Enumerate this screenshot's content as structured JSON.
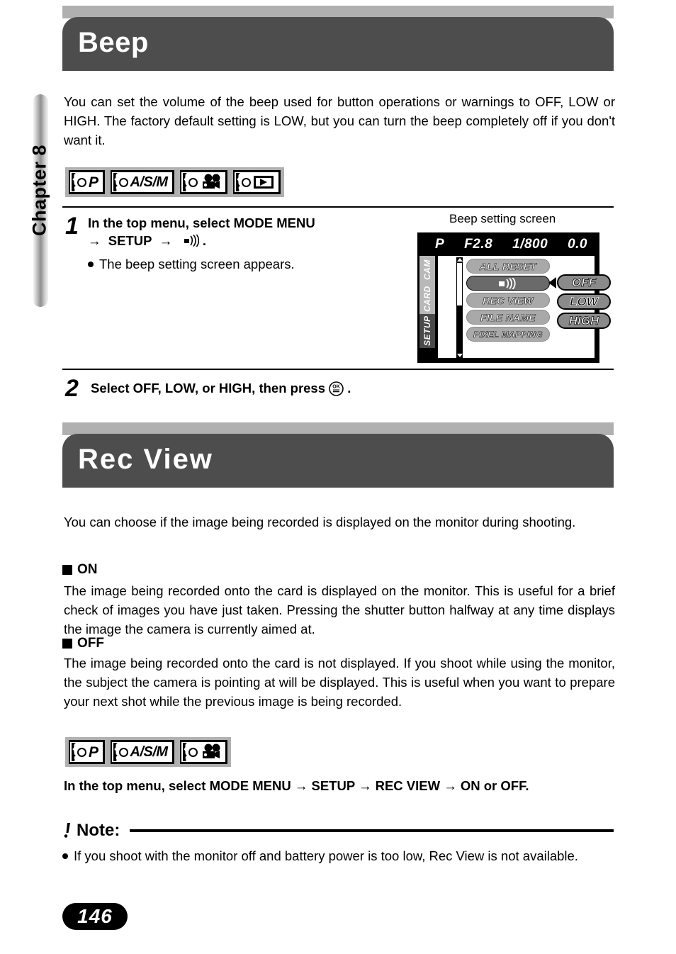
{
  "chapter": {
    "label": "Chapter 8"
  },
  "page": {
    "number": "146"
  },
  "sections": [
    {
      "title": "Beep",
      "intro": "You can set the volume of the beep used for button operations or warnings to OFF, LOW or HIGH. The factory default setting is LOW, but you can turn the beep completely off if you don't want it.",
      "modes": [
        "P",
        "A/S/M",
        "movie-icon",
        "playback-icon"
      ]
    },
    {
      "title": "Rec View",
      "intro": "You can choose if the image being recorded is displayed on the monitor during shooting.",
      "modes": [
        "P",
        "A/S/M",
        "movie-icon"
      ]
    }
  ],
  "steps": [
    {
      "number": "1",
      "text_before": "In the top menu, select MODE MENU",
      "text_arrow_line": "SETUP",
      "icon": "beep-speaker-icon",
      "trailing": ".",
      "sub": "The beep setting screen appears."
    },
    {
      "number": "2",
      "text": "Select OFF, LOW, or HIGH, then press",
      "icon": "ok-button-icon",
      "trailing": "."
    }
  ],
  "lcd": {
    "caption": "Beep setting screen",
    "status": {
      "mode": "P",
      "aperture": "F2.8",
      "shutter": "1/800",
      "exposure": "0.0"
    },
    "tabs": [
      {
        "label": "CAM",
        "selected": false
      },
      {
        "label": "CARD",
        "selected": false
      },
      {
        "label": "SETUP",
        "selected": true
      }
    ],
    "menu_items": [
      {
        "label": "ALL RESET",
        "selected": false
      },
      {
        "label": "beep-speaker-icon",
        "selected": true,
        "is_icon": true
      },
      {
        "label": "REC VIEW",
        "selected": false
      },
      {
        "label": "FILE NAME",
        "selected": false
      },
      {
        "label": "PIXEL MAPPING",
        "selected": false
      }
    ],
    "options": [
      {
        "label": "OFF",
        "active": false
      },
      {
        "label": "LOW",
        "active": true
      },
      {
        "label": "HIGH",
        "active": false
      }
    ]
  },
  "rec_view": {
    "on_heading": "ON",
    "on_text": "The image being recorded onto the card is displayed on the monitor. This is useful for a brief check of images you have just taken. Pressing the shutter button halfway at any time displays the image the camera is currently aimed at.",
    "off_heading": "OFF",
    "off_text": "The image being recorded onto the card is not displayed. If you shoot while using the monitor, the subject the camera is pointing at will be displayed. This is useful when you want to prepare your next shot while the previous image is being recorded.",
    "instruction": "In the top menu, select MODE MENU → SETUP → REC VIEW → ON or OFF."
  },
  "note": {
    "excl": "❗",
    "title": "Note:",
    "items": [
      "If you shoot with the monitor off and battery power is too low, Rec View is not available."
    ]
  },
  "colors": {
    "header_bar": "#4d4d4d",
    "header_gray": "#b0b0b0",
    "lcd_selected": "#6a6a6a",
    "lcd_item": "#a9a9a9"
  }
}
